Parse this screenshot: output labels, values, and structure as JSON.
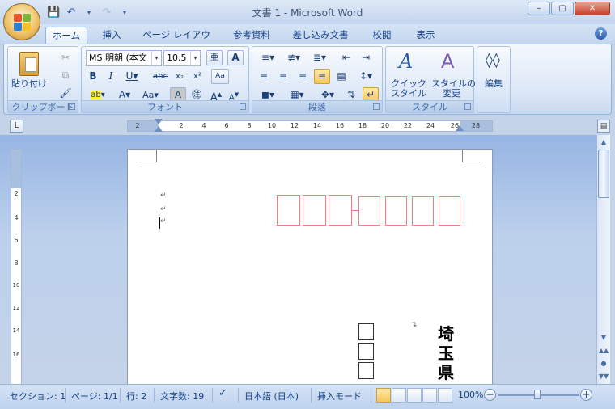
{
  "window": {
    "title": "文書 1 - Microsoft Word"
  },
  "qat": {
    "save_icon": "save-icon",
    "undo_icon": "undo-icon",
    "redo_icon": "redo-icon",
    "customize_icon": "chevron-down-icon"
  },
  "tabs": [
    "ホーム",
    "挿入",
    "ページ レイアウト",
    "参考資料",
    "差し込み文書",
    "校閲",
    "表示"
  ],
  "active_tab": "ホーム",
  "ribbon": {
    "clipboard": {
      "label": "クリップボード",
      "paste": "貼り付け"
    },
    "font": {
      "label": "フォント",
      "font_name": "MS 明朝 (本文",
      "font_size": "10.5"
    },
    "paragraph": {
      "label": "段落"
    },
    "styles": {
      "label": "スタイル",
      "quick_styles": "クイック\nスタイル",
      "change_styles": "スタイルの\n変更"
    },
    "editing": {
      "label": "編集"
    }
  },
  "ruler": {
    "h_numbers": [
      "2",
      "2",
      "4",
      "6",
      "8",
      "10",
      "12",
      "14",
      "16",
      "18",
      "20",
      "22",
      "24",
      "26",
      "28"
    ],
    "v_numbers": [
      "2",
      "4",
      "6",
      "8",
      "10",
      "12",
      "14",
      "16"
    ]
  },
  "document": {
    "address_text": [
      "埼",
      "玉",
      "県"
    ]
  },
  "status": {
    "section": "セクション: 1",
    "page": "ページ: 1/1",
    "line": "行: 2",
    "chars": "文字数: 19",
    "language": "日本語 (日本)",
    "mode": "挿入モード",
    "zoom": "100%"
  },
  "colors": {
    "accent": "#15428b",
    "postal_box": "#f08080"
  }
}
